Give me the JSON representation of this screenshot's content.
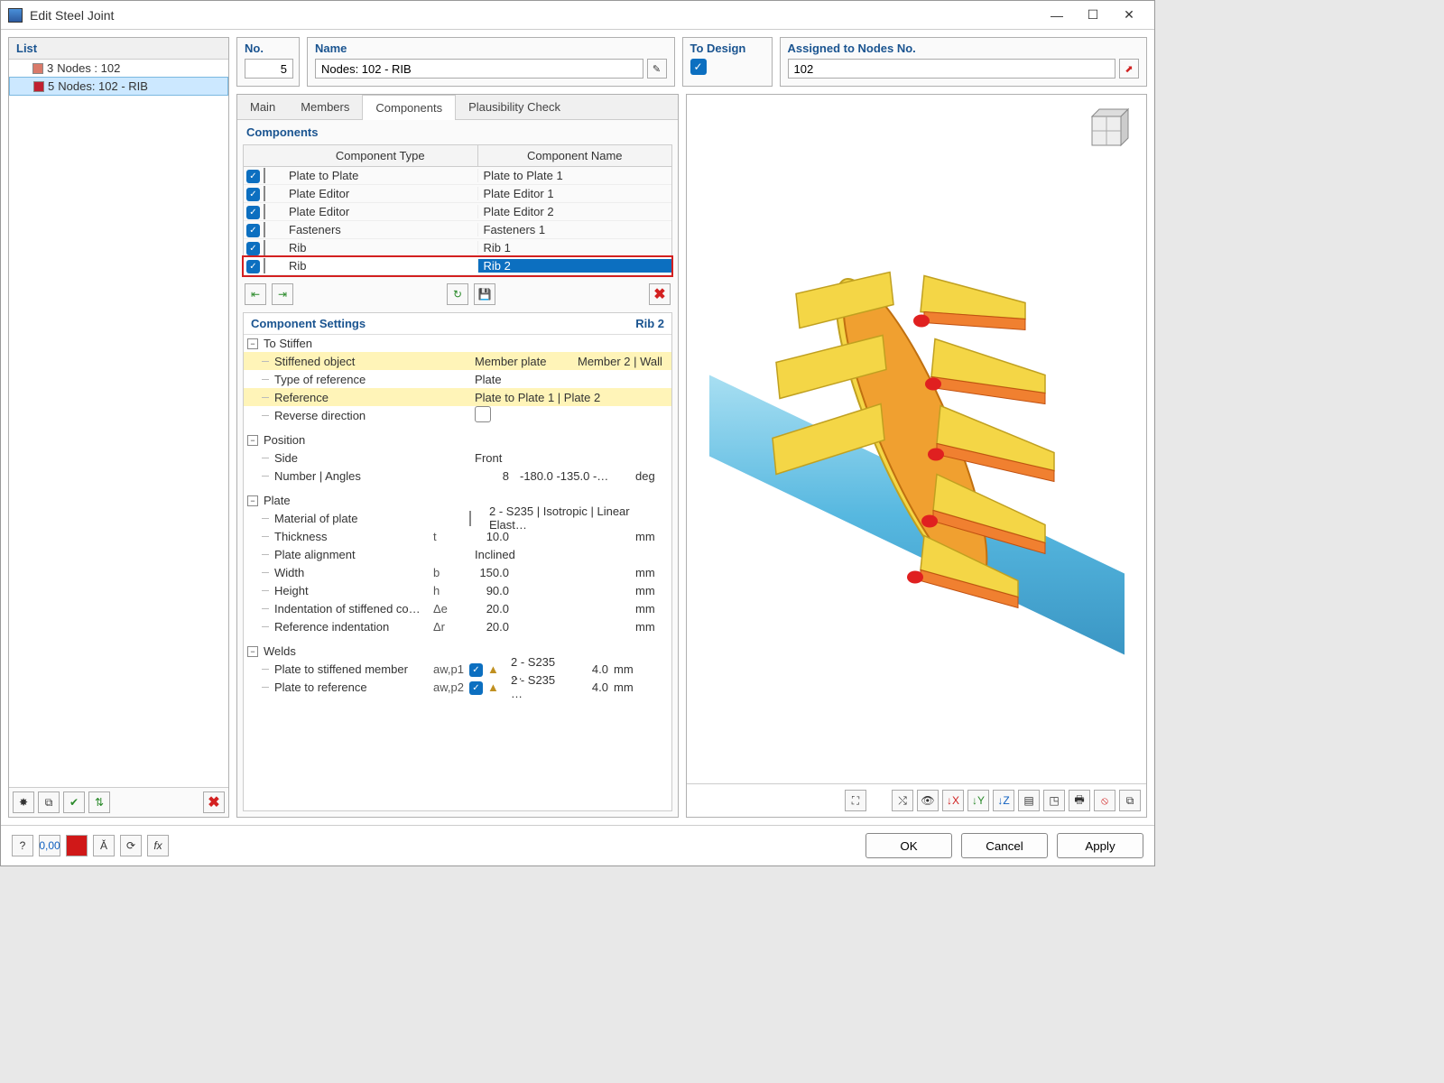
{
  "window": {
    "title": "Edit Steel Joint"
  },
  "list": {
    "header": "List",
    "items": [
      {
        "num": "3",
        "label": "Nodes : 102",
        "color": "#d97a6a",
        "selected": false
      },
      {
        "num": "5",
        "label": "Nodes: 102 - RIB",
        "color": "#c02030",
        "selected": true
      }
    ]
  },
  "fields": {
    "no_label": "No.",
    "no_value": "5",
    "name_label": "Name",
    "name_value": "Nodes: 102 - RIB",
    "todesign_label": "To Design",
    "nodes_label": "Assigned to Nodes No.",
    "nodes_value": "102"
  },
  "tabs": [
    "Main",
    "Members",
    "Components",
    "Plausibility Check"
  ],
  "active_tab": "Components",
  "components": {
    "title": "Components",
    "head_type": "Component Type",
    "head_name": "Component Name",
    "rows": [
      {
        "color": "#3a1fc4",
        "type": "Plate to Plate",
        "name": "Plate to Plate 1"
      },
      {
        "color": "#7ac040",
        "type": "Plate Editor",
        "name": "Plate Editor 1"
      },
      {
        "color": "#7ac040",
        "type": "Plate Editor",
        "name": "Plate Editor 2"
      },
      {
        "color": "#f4f8c0",
        "type": "Fasteners",
        "name": "Fasteners 1"
      },
      {
        "color": "#556b1f",
        "type": "Rib",
        "name": "Rib 1"
      },
      {
        "color": "#556b1f",
        "type": "Rib",
        "name": "Rib 2",
        "selected": true
      }
    ]
  },
  "settings": {
    "title": "Component Settings",
    "current": "Rib 2",
    "groups": [
      {
        "name": "To Stiffen",
        "rows": [
          {
            "label": "Stiffened object",
            "val": "Member plate",
            "val2": "Member 2 | Wall",
            "hl": true
          },
          {
            "label": "Type of reference",
            "val": "Plate"
          },
          {
            "label": "Reference",
            "val": "Plate to Plate 1 | Plate  2",
            "hl": true
          },
          {
            "label": "Reverse direction",
            "checkbox": true
          }
        ]
      },
      {
        "name": "Position",
        "rows": [
          {
            "label": "Side",
            "val": "Front"
          },
          {
            "label": "Number | Angles",
            "sym": "",
            "num": "8",
            "val": "-180.0 -135.0 -…",
            "unit": "deg"
          }
        ]
      },
      {
        "name": "Plate",
        "rows": [
          {
            "label": "Material of plate",
            "swatch": "#f0a020",
            "val": "2 - S235 | Isotropic | Linear Elast…"
          },
          {
            "label": "Thickness",
            "sym": "t",
            "num": "10.0",
            "unit": "mm"
          },
          {
            "label": "Plate alignment",
            "val": "Inclined"
          },
          {
            "label": "Width",
            "sym": "b",
            "num": "150.0",
            "unit": "mm"
          },
          {
            "label": "Height",
            "sym": "h",
            "num": "90.0",
            "unit": "mm"
          },
          {
            "label": "Indentation of stiffened co…",
            "sym": "Δe",
            "num": "20.0",
            "unit": "mm"
          },
          {
            "label": "Reference indentation",
            "sym": "Δr",
            "num": "20.0",
            "unit": "mm"
          }
        ]
      },
      {
        "name": "Welds",
        "rows": [
          {
            "label": "Plate to stiffened member",
            "sym": "aw,p1",
            "chk": true,
            "icon": true,
            "val": "2 - S235 …",
            "num": "4.0",
            "unit": "mm"
          },
          {
            "label": "Plate to reference",
            "sym": "aw,p2",
            "chk": true,
            "icon": true,
            "val": "2 - S235 …",
            "num": "4.0",
            "unit": "mm"
          }
        ]
      }
    ]
  },
  "buttons": {
    "ok": "OK",
    "cancel": "Cancel",
    "apply": "Apply"
  }
}
